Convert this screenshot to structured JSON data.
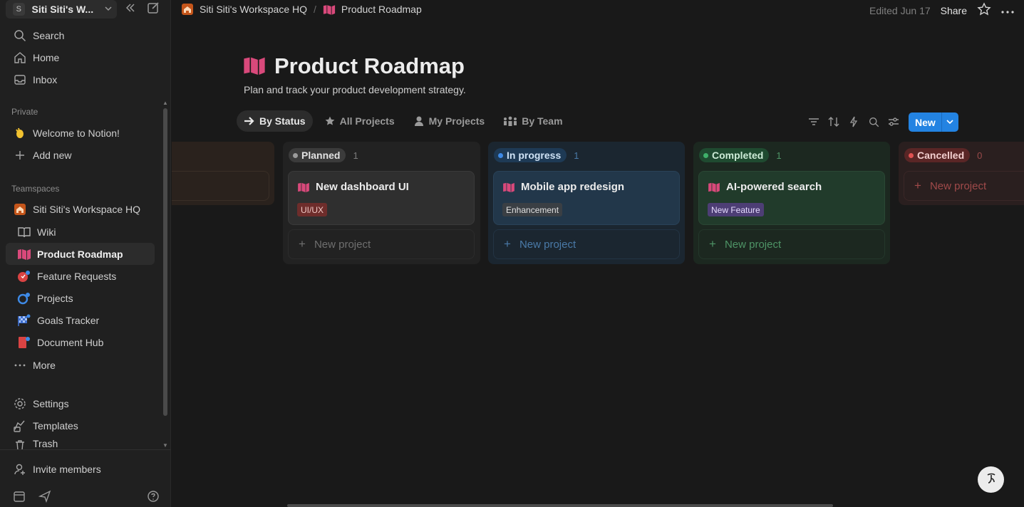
{
  "workspace": {
    "avatar": "S",
    "name": "Siti Siti's W...",
    "icons": [
      "chevron-down-icon",
      "collapse-sidebar-icon",
      "new-page-icon"
    ]
  },
  "sidebar": {
    "search": "Search",
    "home": "Home",
    "inbox": "Inbox",
    "private_label": "Private",
    "welcome": "Welcome to Notion!",
    "add_new": "Add new",
    "teamspaces_label": "Teamspaces",
    "teamspace": "Siti Siti's Workspace HQ",
    "pages": {
      "wiki": "Wiki",
      "roadmap": "Product Roadmap",
      "feature_requests": "Feature Requests",
      "projects": "Projects",
      "goals": "Goals Tracker",
      "docs": "Document Hub"
    },
    "more": "More",
    "settings": "Settings",
    "templates": "Templates",
    "trash": "Trash",
    "invite": "Invite members"
  },
  "topbar": {
    "crumb_workspace": "Siti Siti's Workspace HQ",
    "crumb_sep": "/",
    "crumb_page": "Product Roadmap",
    "edited": "Edited Jun 17",
    "share": "Share"
  },
  "page": {
    "title": "Product Roadmap",
    "description": "Plan and track your product development strategy."
  },
  "tabs": {
    "by_status": "By Status",
    "all_projects": "All Projects",
    "my_projects": "My Projects",
    "by_team": "By Team"
  },
  "toolbar": {
    "new_label": "New",
    "tools": [
      "filter-icon",
      "sort-icon",
      "automation-icon",
      "search-icon",
      "settings-icon"
    ]
  },
  "board": {
    "new_project": "New project",
    "planned": {
      "label": "Planned",
      "count": "1",
      "card_title": "New dashboard UI",
      "tag": "UI/UX"
    },
    "in_progress": {
      "label": "In progress",
      "count": "1",
      "card_title": "Mobile app redesign",
      "tag": "Enhancement"
    },
    "completed": {
      "label": "Completed",
      "count": "1",
      "card_title": "AI-powered search",
      "tag": "New Feature"
    },
    "cancelled": {
      "label": "Cancelled",
      "count": "0"
    }
  },
  "colors": {
    "accent": "#2383e2",
    "roadmap_icon": "#d9497b",
    "planned": "#3b3b3b",
    "in_progress": "#1e3140",
    "completed": "#1f3227",
    "cancelled": "#3a2323"
  }
}
